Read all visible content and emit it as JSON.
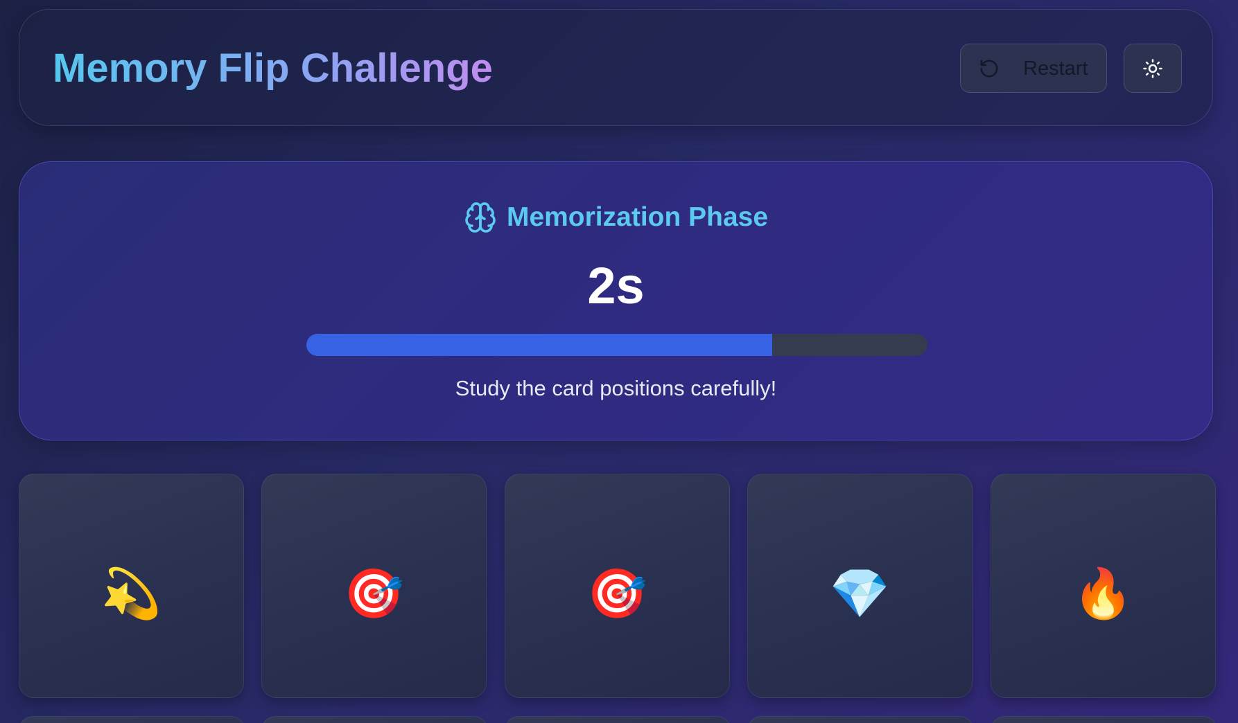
{
  "header": {
    "title": "Memory Flip Challenge",
    "restart_label": "Restart",
    "restart_icon": "rotate-ccw-icon",
    "theme_icon": "sun-icon"
  },
  "phase": {
    "icon": "brain-icon",
    "title": "Memorization Phase",
    "countdown": "2s",
    "progress_fraction": 0.75,
    "hint": "Study the card positions carefully!"
  },
  "cards": [
    {
      "emoji": "💫",
      "face_up": true
    },
    {
      "emoji": "🎯",
      "face_up": true
    },
    {
      "emoji": "🎯",
      "face_up": true
    },
    {
      "emoji": "💎",
      "face_up": true
    },
    {
      "emoji": "🔥",
      "face_up": true
    }
  ],
  "colors": {
    "title_gradient_start": "#56c7ee",
    "title_gradient_end": "#c08cf0",
    "phase_title": "#5cc9ee",
    "progress_fill": "#3762e4",
    "progress_track": "#353c50"
  }
}
